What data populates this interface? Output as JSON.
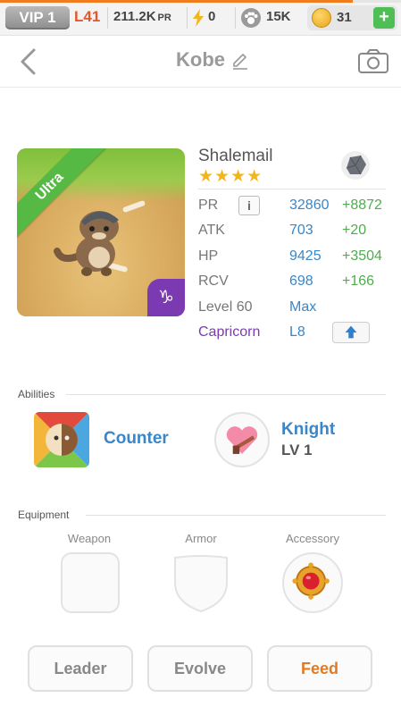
{
  "topbar": {
    "vip": "VIP 1",
    "level": "L41",
    "power": "211.2K",
    "power_unit": "PR",
    "energy": "0",
    "food": "15K",
    "coins": "31",
    "add_label": "+",
    "progress_fraction": 0.88
  },
  "header": {
    "title": "Kobe"
  },
  "pet": {
    "rarity": "Ultra",
    "name": "Shalemail",
    "stars": "★★★★",
    "zodiac_glyph": "♑",
    "stats": [
      {
        "label": "PR",
        "value": "32860",
        "bonus": "+8872"
      },
      {
        "label": "ATK",
        "value": "703",
        "bonus": "+20"
      },
      {
        "label": "HP",
        "value": "9425",
        "bonus": "+3504"
      },
      {
        "label": "RCV",
        "value": "698",
        "bonus": "+166"
      }
    ],
    "level_label": "Level 60",
    "level_value": "Max",
    "zodiac_label": "Capricorn",
    "zodiac_level": "L8",
    "info_label": "i"
  },
  "abilities": {
    "section_label": "Abilities",
    "ability_name": "Counter",
    "class_name": "Knight",
    "class_level": "LV 1"
  },
  "equipment": {
    "section_label": "Equipment",
    "slots": [
      {
        "label": "Weapon"
      },
      {
        "label": "Armor"
      },
      {
        "label": "Accessory"
      }
    ]
  },
  "actions": {
    "leader": "Leader",
    "evolve": "Evolve",
    "feed": "Feed"
  },
  "colors": {
    "accent_blue": "#3a86c8",
    "bonus_green": "#4cae4c",
    "feed_orange": "#e07b22",
    "zodiac_purple": "#7b3ab2",
    "rarity_green": "#55b944"
  }
}
